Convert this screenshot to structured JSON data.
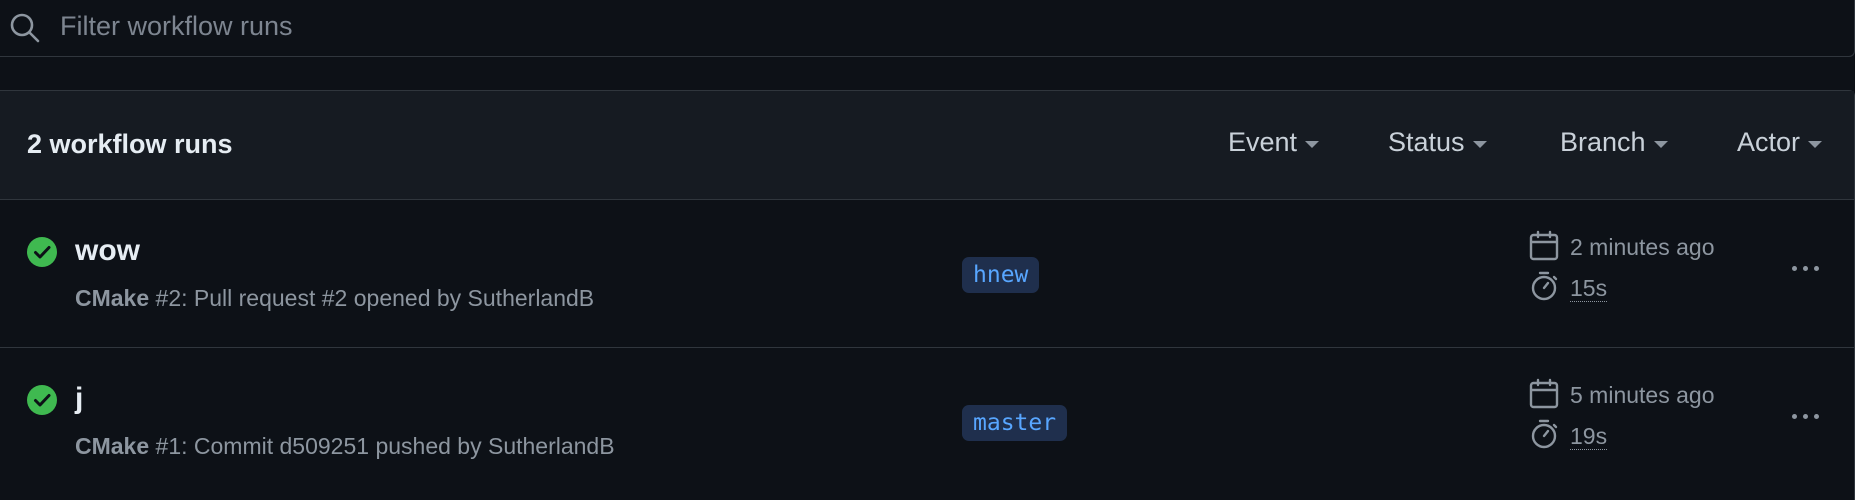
{
  "search": {
    "placeholder": "Filter workflow runs",
    "value": "",
    "icon": "search-icon"
  },
  "header": {
    "count_label": "2 workflow runs",
    "filters": [
      {
        "label": "Event"
      },
      {
        "label": "Status"
      },
      {
        "label": "Branch"
      },
      {
        "label": "Actor"
      }
    ]
  },
  "runs": [
    {
      "status": "success",
      "status_icon": "check-circle-icon",
      "title": "wow",
      "workflow": "CMake",
      "subtitle_rest": " #2: Pull request #2 opened by SutherlandB",
      "branch": "hnew",
      "time_ago": "2 minutes ago",
      "duration": "15s"
    },
    {
      "status": "success",
      "status_icon": "check-circle-icon",
      "title": "j",
      "workflow": "CMake",
      "subtitle_rest": " #1: Commit d509251 pushed by SutherlandB",
      "branch": "master",
      "time_ago": "5 minutes ago",
      "duration": "19s"
    }
  ],
  "colors": {
    "background": "#0d1117",
    "header_bg": "#161b22",
    "border": "#30363d",
    "success": "#3fb950",
    "branch_bg": "#1f2f4d",
    "branch_text": "#58a6ff",
    "muted_text": "#8d96a0"
  }
}
